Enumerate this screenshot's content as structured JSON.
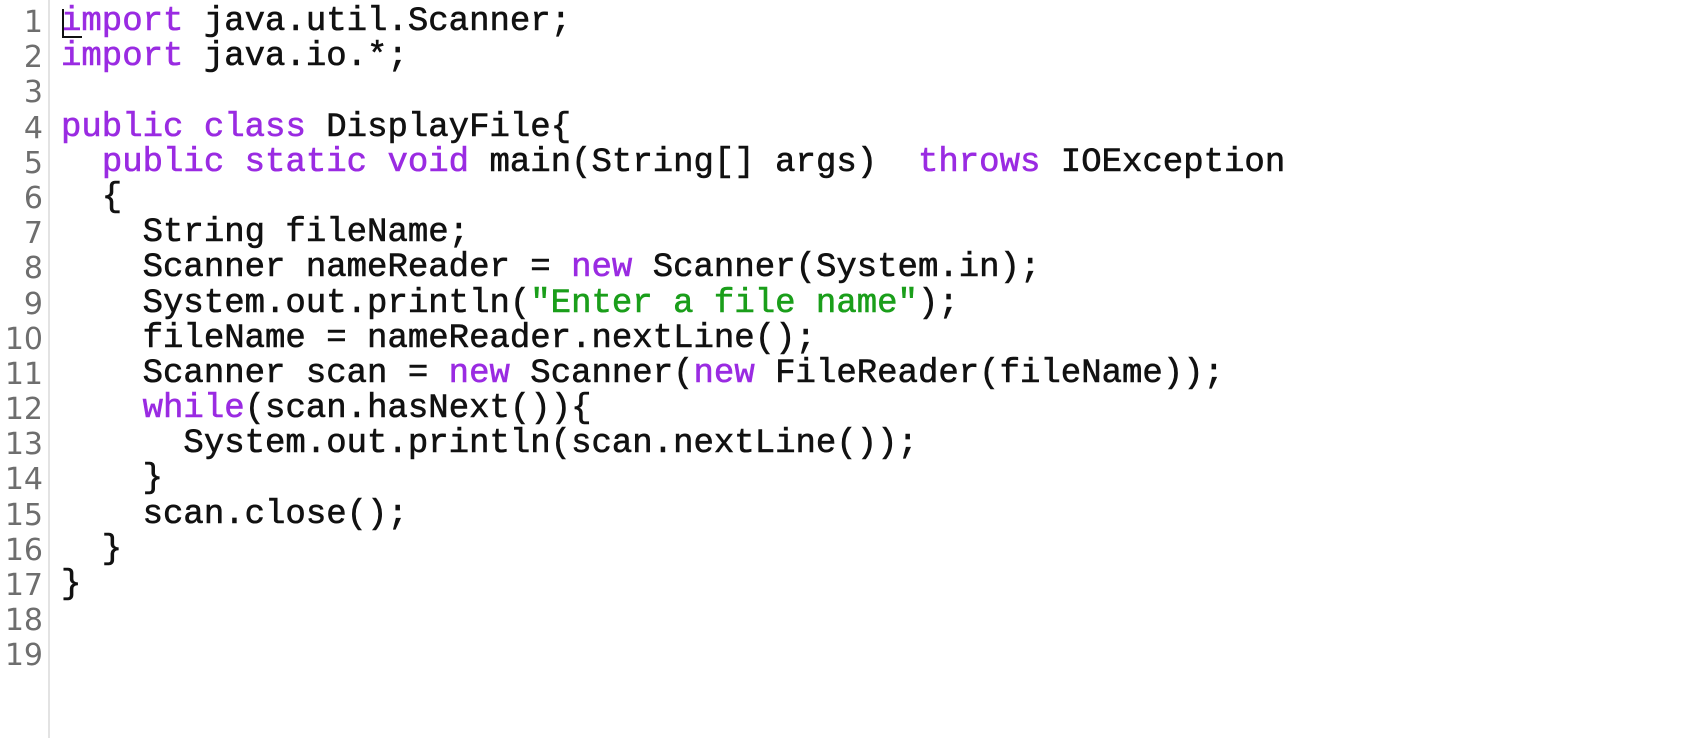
{
  "editor": {
    "language": "java",
    "colors": {
      "keyword": "#9a2be2",
      "string": "#1a9e1a",
      "text": "#111111",
      "line_number": "#6e6e6e"
    },
    "cursor": {
      "line": 1,
      "column": 1
    },
    "lines": [
      {
        "n": "1",
        "tokens": [
          {
            "t": "kw",
            "v": "import"
          },
          {
            "t": "plain",
            "v": " java.util.Scanner;"
          }
        ]
      },
      {
        "n": "2",
        "tokens": [
          {
            "t": "kw",
            "v": "import"
          },
          {
            "t": "plain",
            "v": " java.io.*;"
          }
        ]
      },
      {
        "n": "3",
        "tokens": []
      },
      {
        "n": "4",
        "tokens": [
          {
            "t": "kw",
            "v": "public"
          },
          {
            "t": "plain",
            "v": " "
          },
          {
            "t": "kw",
            "v": "class"
          },
          {
            "t": "plain",
            "v": " DisplayFile{"
          }
        ]
      },
      {
        "n": "5",
        "tokens": [
          {
            "t": "plain",
            "v": "  "
          },
          {
            "t": "kw",
            "v": "public"
          },
          {
            "t": "plain",
            "v": " "
          },
          {
            "t": "kw",
            "v": "static"
          },
          {
            "t": "plain",
            "v": " "
          },
          {
            "t": "kw",
            "v": "void"
          },
          {
            "t": "plain",
            "v": " main(String[] args)  "
          },
          {
            "t": "kw",
            "v": "throws"
          },
          {
            "t": "plain",
            "v": " IOException"
          }
        ]
      },
      {
        "n": "6",
        "tokens": [
          {
            "t": "plain",
            "v": "  {"
          }
        ]
      },
      {
        "n": "7",
        "tokens": [
          {
            "t": "plain",
            "v": "    String fileName;"
          }
        ]
      },
      {
        "n": "8",
        "tokens": [
          {
            "t": "plain",
            "v": "    Scanner nameReader = "
          },
          {
            "t": "kw",
            "v": "new"
          },
          {
            "t": "plain",
            "v": " Scanner(System.in);"
          }
        ]
      },
      {
        "n": "9",
        "tokens": [
          {
            "t": "plain",
            "v": "    System.out.println("
          },
          {
            "t": "str",
            "v": "\"Enter a file name\""
          },
          {
            "t": "plain",
            "v": ");"
          }
        ]
      },
      {
        "n": "10",
        "tokens": [
          {
            "t": "plain",
            "v": "    fileName = nameReader.nextLine();"
          }
        ]
      },
      {
        "n": "11",
        "tokens": [
          {
            "t": "plain",
            "v": "    Scanner scan = "
          },
          {
            "t": "kw",
            "v": "new"
          },
          {
            "t": "plain",
            "v": " Scanner("
          },
          {
            "t": "kw",
            "v": "new"
          },
          {
            "t": "plain",
            "v": " FileReader(fileName));"
          }
        ]
      },
      {
        "n": "12",
        "tokens": [
          {
            "t": "plain",
            "v": "    "
          },
          {
            "t": "kw",
            "v": "while"
          },
          {
            "t": "plain",
            "v": "(scan.hasNext()){"
          }
        ]
      },
      {
        "n": "13",
        "tokens": [
          {
            "t": "plain",
            "v": "      System.out.println(scan.nextLine());"
          }
        ]
      },
      {
        "n": "14",
        "tokens": [
          {
            "t": "plain",
            "v": "    }"
          }
        ]
      },
      {
        "n": "15",
        "tokens": [
          {
            "t": "plain",
            "v": "    scan.close();"
          }
        ]
      },
      {
        "n": "16",
        "tokens": [
          {
            "t": "plain",
            "v": "  }"
          }
        ]
      },
      {
        "n": "17",
        "tokens": [
          {
            "t": "plain",
            "v": "}"
          }
        ]
      },
      {
        "n": "18",
        "tokens": []
      },
      {
        "n": "19",
        "tokens": []
      }
    ]
  }
}
